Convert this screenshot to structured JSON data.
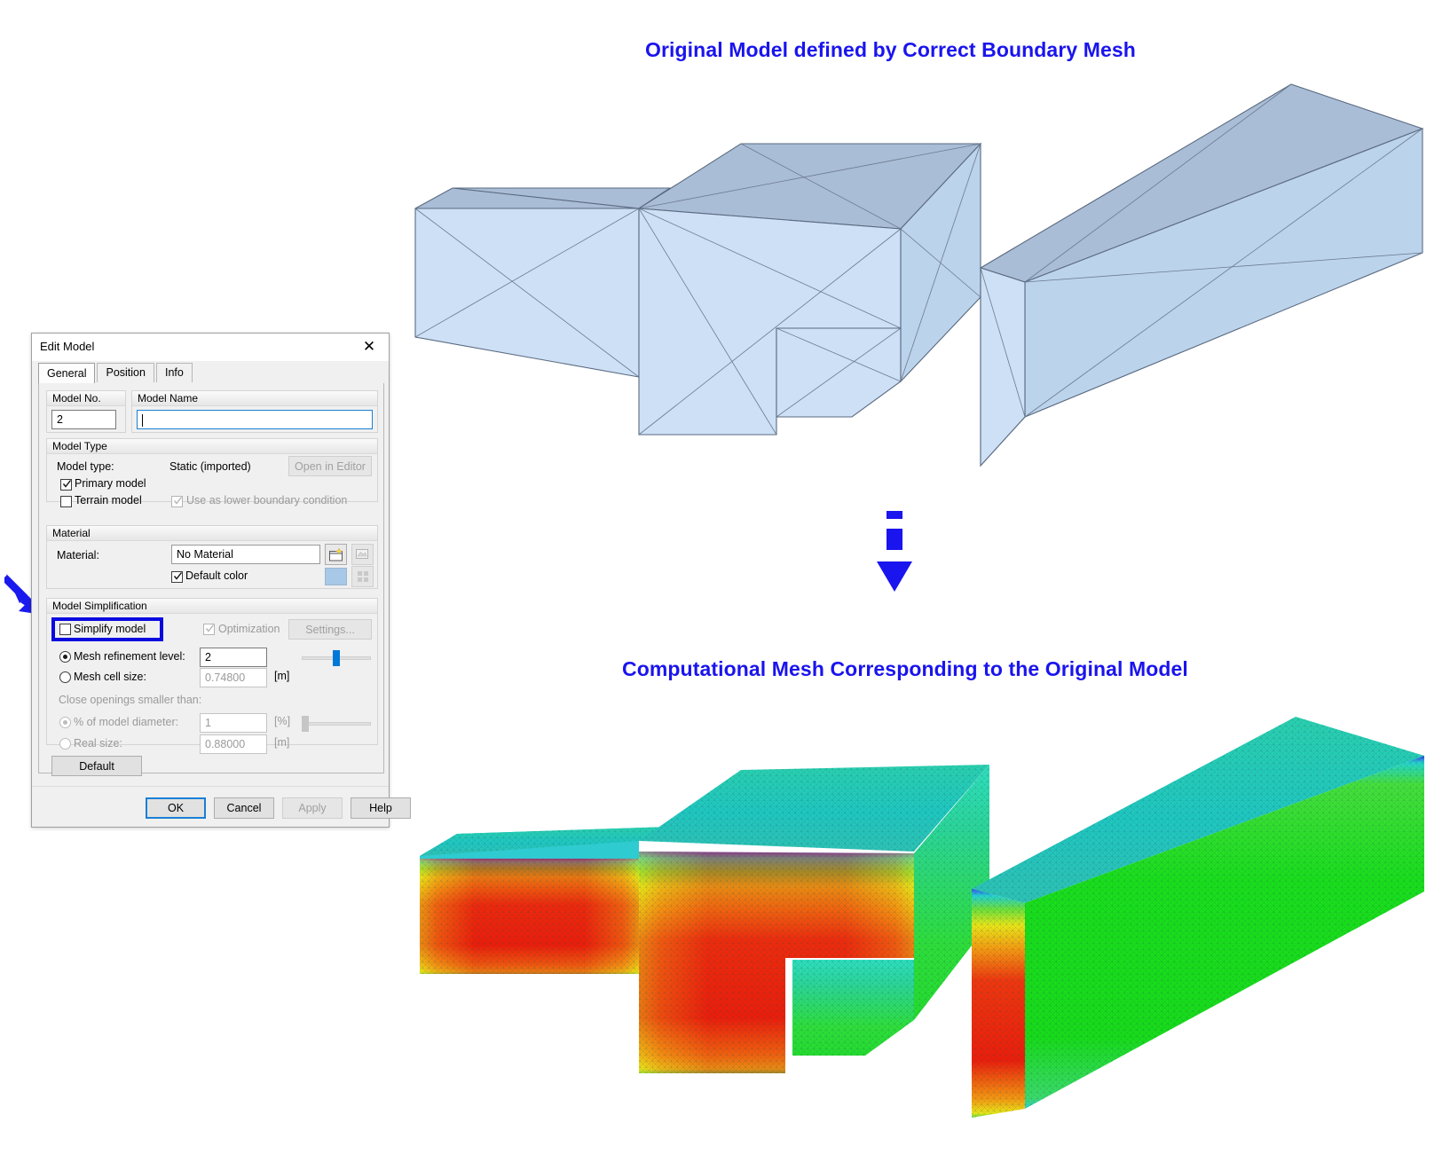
{
  "figure": {
    "caption_top": "Original Model defined by Correct Boundary Mesh",
    "caption_bottom": "Computational Mesh Corresponding to the Original Model",
    "caption_color": "#1a14ee",
    "flow_arrow": "dashed-down-arrow",
    "pointer_arrow": "diagonal-pointer-arrow",
    "viewport_original_alt": "3D boundary-mesh model shaded light blue with triangular facet edges",
    "viewport_mesh_alt": "3D computational mesh colored with a rainbow field (red core, green/cyan surfaces)"
  },
  "dialog": {
    "title": "Edit Model",
    "close_label": "✕",
    "tabs": [
      {
        "label": "General",
        "active": true
      },
      {
        "label": "Position",
        "active": false
      },
      {
        "label": "Info",
        "active": false
      }
    ],
    "model_no": {
      "group_label": "Model No.",
      "value": "2"
    },
    "model_name": {
      "group_label": "Model Name",
      "value": "",
      "placeholder": ""
    },
    "model_type": {
      "group_label": "Model Type",
      "type_label": "Model type:",
      "type_value": "Static (imported)",
      "open_in_editor_label": "Open in Editor",
      "open_in_editor_enabled": false,
      "primary_model_label": "Primary model",
      "primary_model_checked": true,
      "terrain_model_label": "Terrain model",
      "terrain_model_checked": false,
      "lower_boundary_label": "Use as lower boundary condition",
      "lower_boundary_checked": true,
      "lower_boundary_enabled": false
    },
    "material": {
      "group_label": "Material",
      "label": "Material:",
      "selected": "No Material",
      "options": [
        "No Material"
      ],
      "new_material_icon": "new-material-icon",
      "edit_material_icon": "edit-material-icon",
      "edit_material_enabled": false,
      "default_color_label": "Default color",
      "default_color_checked": true,
      "default_color_value": "#a8c8e8",
      "color_palette_icon": "palette-icon",
      "color_palette_enabled": false
    },
    "simplification": {
      "group_label": "Model Simplification",
      "simplify_model_label": "Simplify model",
      "simplify_model_checked": false,
      "optimization_label": "Optimization",
      "optimization_checked": true,
      "optimization_enabled": false,
      "settings_label": "Settings...",
      "settings_enabled": false,
      "mesh_refinement_label": "Mesh refinement level:",
      "mesh_refinement_selected": true,
      "mesh_refinement_value": "2",
      "mesh_refinement_slider_pct": 62,
      "mesh_cell_size_label": "Mesh cell size:",
      "mesh_cell_size_selected": false,
      "mesh_cell_size_value": "0.74800",
      "mesh_cell_size_unit": "[m]",
      "close_openings_label": "Close openings smaller than:",
      "pct_diameter_label": "% of model diameter:",
      "pct_diameter_selected": true,
      "pct_diameter_value": "1",
      "pct_diameter_unit": "[%]",
      "pct_diameter_slider_pct": 2,
      "real_size_label": "Real size:",
      "real_size_selected": false,
      "real_size_value": "0.88000",
      "real_size_unit": "[m]",
      "default_button_label": "Default"
    },
    "footer": {
      "ok_label": "OK",
      "cancel_label": "Cancel",
      "apply_label": "Apply",
      "apply_enabled": false,
      "help_label": "Help"
    },
    "highlight_color": "#0a0ae0"
  }
}
